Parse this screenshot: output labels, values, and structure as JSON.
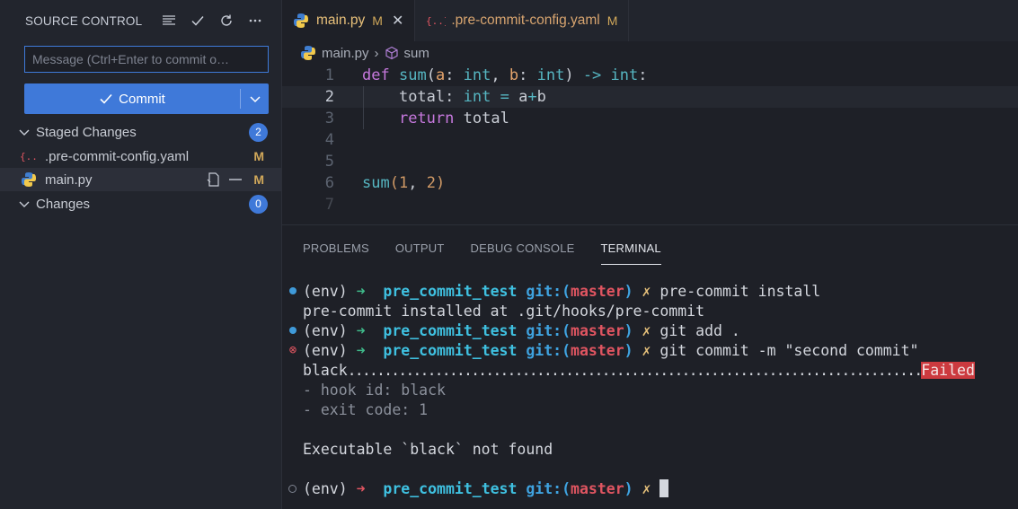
{
  "sidebar": {
    "title": "SOURCE CONTROL",
    "message_placeholder": "Message (Ctrl+Enter to commit o…",
    "commit_label": "Commit",
    "staged": {
      "label": "Staged Changes",
      "count": "2"
    },
    "staged_files": [
      {
        "name": ".pre-commit-config.yaml",
        "status": "M",
        "icon": "yaml-icon"
      },
      {
        "name": "main.py",
        "status": "M",
        "icon": "python-icon"
      }
    ],
    "changes": {
      "label": "Changes",
      "count": "0"
    }
  },
  "tabs": [
    {
      "label": "main.py",
      "status": "M",
      "active": true
    },
    {
      "label": ".pre-commit-config.yaml",
      "status": "M",
      "active": false
    }
  ],
  "breadcrumb": {
    "file": "main.py",
    "symbol": "sum"
  },
  "code_lines": [
    {
      "num": "1",
      "text": "def sum(a: int, b: int) -> int:"
    },
    {
      "num": "2",
      "text": "    total: int = a+b"
    },
    {
      "num": "3",
      "text": "    return total"
    },
    {
      "num": "4",
      "text": ""
    },
    {
      "num": "5",
      "text": ""
    },
    {
      "num": "6",
      "text": "sum(1, 2)"
    },
    {
      "num": "7",
      "text": ""
    }
  ],
  "panel_tabs": [
    "PROBLEMS",
    "OUTPUT",
    "DEBUG CONSOLE",
    "TERMINAL"
  ],
  "terminal": {
    "env": "(env)",
    "dir": "pre_commit_test",
    "git_prefix": "git:(",
    "branch": "master",
    "git_suffix": ")",
    "mark": "✗",
    "cmd1": "pre-commit install",
    "out1": "pre-commit installed at .git/hooks/pre-commit",
    "cmd2": "git add .",
    "cmd3": "git commit -m \"second commit\"",
    "hook_name": "black",
    "hook_dots": "...............................................................................",
    "hook_result": "Failed",
    "hook_id": "- hook id: black",
    "exit_code": "- exit code: 1",
    "error_msg": "Executable `black` not found"
  }
}
